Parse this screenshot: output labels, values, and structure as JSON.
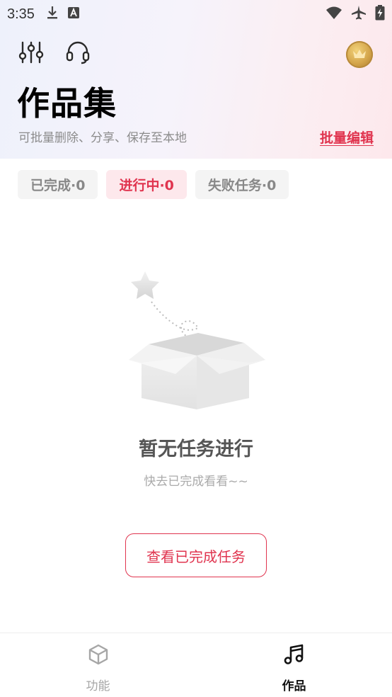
{
  "status_bar": {
    "time": "3:35",
    "left_icons": [
      "download-icon",
      "a-icon"
    ],
    "right_icons": [
      "wifi-icon",
      "airplane-icon",
      "battery-charging-icon"
    ]
  },
  "header": {
    "tool_icons": [
      "sliders-icon",
      "headset-icon"
    ],
    "avatar_icon": "crown-icon",
    "title": "作品集",
    "subtitle": "可批量删除、分享、保存至本地",
    "batch_edit_label": "批量编辑"
  },
  "tabs": [
    {
      "label": "已完成·0",
      "active": false
    },
    {
      "label": "进行中·0",
      "active": true
    },
    {
      "label": "失败任务·0",
      "active": false
    }
  ],
  "empty_state": {
    "illustration": "empty-box-star-illustration",
    "title": "暂无任务进行",
    "subtitle": "快去已完成看看~~",
    "button_label": "查看已完成任务"
  },
  "bottom_nav": [
    {
      "label": "功能",
      "icon": "cube-icon",
      "active": false
    },
    {
      "label": "作品",
      "icon": "music-note-icon",
      "active": true
    }
  ],
  "colors": {
    "accent": "#e0344f",
    "accent_bg": "#fde8ec",
    "tab_bg": "#f4f4f4",
    "muted_text": "#8c8c8c"
  }
}
